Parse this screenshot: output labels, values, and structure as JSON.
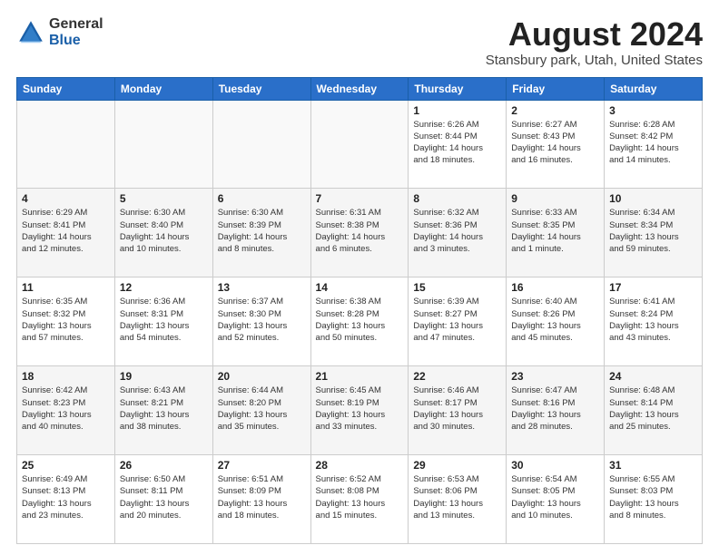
{
  "logo": {
    "general": "General",
    "blue": "Blue"
  },
  "header": {
    "title": "August 2024",
    "subtitle": "Stansbury park, Utah, United States"
  },
  "weekdays": [
    "Sunday",
    "Monday",
    "Tuesday",
    "Wednesday",
    "Thursday",
    "Friday",
    "Saturday"
  ],
  "weeks": [
    [
      {
        "day": "",
        "info": ""
      },
      {
        "day": "",
        "info": ""
      },
      {
        "day": "",
        "info": ""
      },
      {
        "day": "",
        "info": ""
      },
      {
        "day": "1",
        "info": "Sunrise: 6:26 AM\nSunset: 8:44 PM\nDaylight: 14 hours\nand 18 minutes."
      },
      {
        "day": "2",
        "info": "Sunrise: 6:27 AM\nSunset: 8:43 PM\nDaylight: 14 hours\nand 16 minutes."
      },
      {
        "day": "3",
        "info": "Sunrise: 6:28 AM\nSunset: 8:42 PM\nDaylight: 14 hours\nand 14 minutes."
      }
    ],
    [
      {
        "day": "4",
        "info": "Sunrise: 6:29 AM\nSunset: 8:41 PM\nDaylight: 14 hours\nand 12 minutes."
      },
      {
        "day": "5",
        "info": "Sunrise: 6:30 AM\nSunset: 8:40 PM\nDaylight: 14 hours\nand 10 minutes."
      },
      {
        "day": "6",
        "info": "Sunrise: 6:30 AM\nSunset: 8:39 PM\nDaylight: 14 hours\nand 8 minutes."
      },
      {
        "day": "7",
        "info": "Sunrise: 6:31 AM\nSunset: 8:38 PM\nDaylight: 14 hours\nand 6 minutes."
      },
      {
        "day": "8",
        "info": "Sunrise: 6:32 AM\nSunset: 8:36 PM\nDaylight: 14 hours\nand 3 minutes."
      },
      {
        "day": "9",
        "info": "Sunrise: 6:33 AM\nSunset: 8:35 PM\nDaylight: 14 hours\nand 1 minute."
      },
      {
        "day": "10",
        "info": "Sunrise: 6:34 AM\nSunset: 8:34 PM\nDaylight: 13 hours\nand 59 minutes."
      }
    ],
    [
      {
        "day": "11",
        "info": "Sunrise: 6:35 AM\nSunset: 8:32 PM\nDaylight: 13 hours\nand 57 minutes."
      },
      {
        "day": "12",
        "info": "Sunrise: 6:36 AM\nSunset: 8:31 PM\nDaylight: 13 hours\nand 54 minutes."
      },
      {
        "day": "13",
        "info": "Sunrise: 6:37 AM\nSunset: 8:30 PM\nDaylight: 13 hours\nand 52 minutes."
      },
      {
        "day": "14",
        "info": "Sunrise: 6:38 AM\nSunset: 8:28 PM\nDaylight: 13 hours\nand 50 minutes."
      },
      {
        "day": "15",
        "info": "Sunrise: 6:39 AM\nSunset: 8:27 PM\nDaylight: 13 hours\nand 47 minutes."
      },
      {
        "day": "16",
        "info": "Sunrise: 6:40 AM\nSunset: 8:26 PM\nDaylight: 13 hours\nand 45 minutes."
      },
      {
        "day": "17",
        "info": "Sunrise: 6:41 AM\nSunset: 8:24 PM\nDaylight: 13 hours\nand 43 minutes."
      }
    ],
    [
      {
        "day": "18",
        "info": "Sunrise: 6:42 AM\nSunset: 8:23 PM\nDaylight: 13 hours\nand 40 minutes."
      },
      {
        "day": "19",
        "info": "Sunrise: 6:43 AM\nSunset: 8:21 PM\nDaylight: 13 hours\nand 38 minutes."
      },
      {
        "day": "20",
        "info": "Sunrise: 6:44 AM\nSunset: 8:20 PM\nDaylight: 13 hours\nand 35 minutes."
      },
      {
        "day": "21",
        "info": "Sunrise: 6:45 AM\nSunset: 8:19 PM\nDaylight: 13 hours\nand 33 minutes."
      },
      {
        "day": "22",
        "info": "Sunrise: 6:46 AM\nSunset: 8:17 PM\nDaylight: 13 hours\nand 30 minutes."
      },
      {
        "day": "23",
        "info": "Sunrise: 6:47 AM\nSunset: 8:16 PM\nDaylight: 13 hours\nand 28 minutes."
      },
      {
        "day": "24",
        "info": "Sunrise: 6:48 AM\nSunset: 8:14 PM\nDaylight: 13 hours\nand 25 minutes."
      }
    ],
    [
      {
        "day": "25",
        "info": "Sunrise: 6:49 AM\nSunset: 8:13 PM\nDaylight: 13 hours\nand 23 minutes."
      },
      {
        "day": "26",
        "info": "Sunrise: 6:50 AM\nSunset: 8:11 PM\nDaylight: 13 hours\nand 20 minutes."
      },
      {
        "day": "27",
        "info": "Sunrise: 6:51 AM\nSunset: 8:09 PM\nDaylight: 13 hours\nand 18 minutes."
      },
      {
        "day": "28",
        "info": "Sunrise: 6:52 AM\nSunset: 8:08 PM\nDaylight: 13 hours\nand 15 minutes."
      },
      {
        "day": "29",
        "info": "Sunrise: 6:53 AM\nSunset: 8:06 PM\nDaylight: 13 hours\nand 13 minutes."
      },
      {
        "day": "30",
        "info": "Sunrise: 6:54 AM\nSunset: 8:05 PM\nDaylight: 13 hours\nand 10 minutes."
      },
      {
        "day": "31",
        "info": "Sunrise: 6:55 AM\nSunset: 8:03 PM\nDaylight: 13 hours\nand 8 minutes."
      }
    ]
  ]
}
